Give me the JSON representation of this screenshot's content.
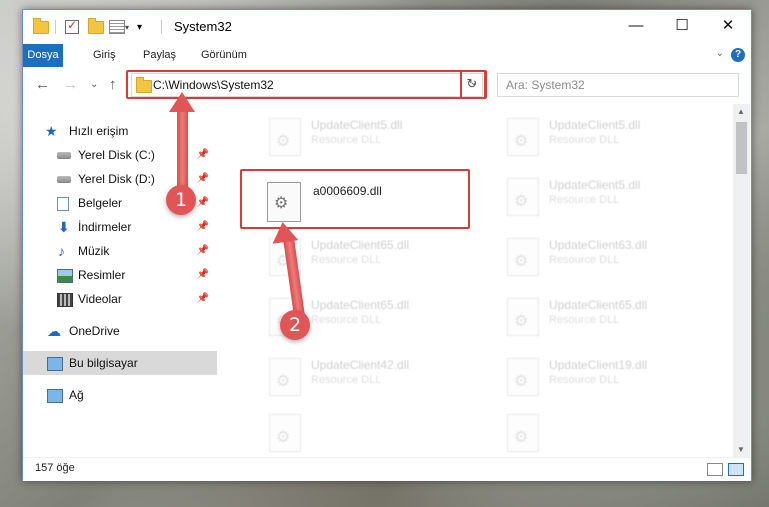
{
  "window": {
    "title": "System32",
    "buttons": {
      "minimize": "—",
      "maximize": "☐",
      "close": "✕"
    }
  },
  "ribbon": {
    "tabs": [
      "Dosya",
      "Giriş",
      "Paylaş",
      "Görünüm"
    ],
    "collapse_glyph": "⌄",
    "help_glyph": "?"
  },
  "nav": {
    "back": "←",
    "forward": "→",
    "recent": "⌄",
    "up": "↑",
    "address": "C:\\Windows\\System32",
    "refresh": "↻",
    "search_placeholder": "Ara: System32"
  },
  "sidebar": {
    "items": [
      {
        "label": "Hızlı erişim",
        "icon": "star-icon"
      },
      {
        "label": "Yerel Disk (C:)",
        "icon": "drive-icon",
        "pinned": true
      },
      {
        "label": "Yerel Disk (D:)",
        "icon": "drive-icon",
        "pinned": true
      },
      {
        "label": "Belgeler",
        "icon": "documents-icon",
        "pinned": true
      },
      {
        "label": "İndirmeler",
        "icon": "downloads-icon",
        "pinned": true
      },
      {
        "label": "Müzik",
        "icon": "music-icon",
        "pinned": true
      },
      {
        "label": "Resimler",
        "icon": "pictures-icon",
        "pinned": true
      },
      {
        "label": "Videolar",
        "icon": "videos-icon",
        "pinned": true
      },
      {
        "label": "OneDrive",
        "icon": "cloud-icon"
      },
      {
        "label": "Bu bilgisayar",
        "icon": "computer-icon",
        "selected": true
      },
      {
        "label": "Ağ",
        "icon": "network-icon"
      }
    ]
  },
  "files": [
    {
      "name": "UpdateClient5.dll",
      "type": "Resource DLL"
    },
    {
      "name": "UpdateClient5.dll",
      "type": "Resource DLL"
    },
    {
      "name": "a0006609.dll",
      "type": ""
    },
    {
      "name": "UpdateClient5.dll",
      "type": "Resource DLL"
    },
    {
      "name": "UpdateClient65.dll",
      "type": "Resource DLL"
    },
    {
      "name": "UpdateClient63.dll",
      "type": "Resource DLL"
    },
    {
      "name": "UpdateClient65.dll",
      "type": "Resource DLL"
    },
    {
      "name": "UpdateClient65.dll",
      "type": "Resource DLL"
    },
    {
      "name": "UpdateClient42.dll",
      "type": "Resource DLL"
    },
    {
      "name": "UpdateClient19.dll",
      "type": "Resource DLL"
    },
    {
      "name": "",
      "type": ""
    },
    {
      "name": "",
      "type": ""
    }
  ],
  "status": {
    "count": "157 öğe"
  },
  "callouts": {
    "one": "1",
    "two": "2"
  },
  "colors": {
    "accent": "#1a6fc1",
    "highlight": "#d93a3a",
    "callout": "#e05555"
  }
}
